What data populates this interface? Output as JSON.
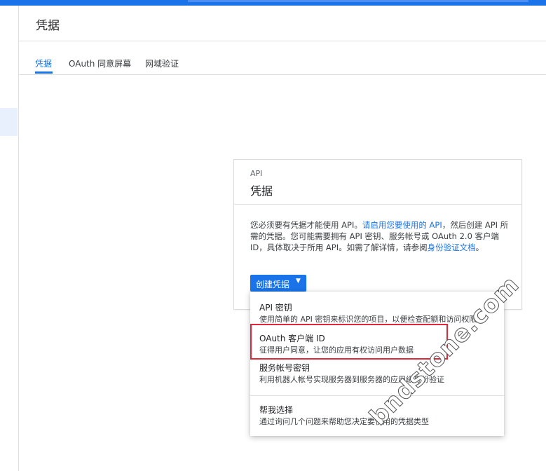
{
  "header": {
    "title": "凭据"
  },
  "tabs": [
    {
      "label": "凭据",
      "active": true
    },
    {
      "label": "OAuth 同意屏幕",
      "active": false
    },
    {
      "label": "网域验证",
      "active": false
    }
  ],
  "card": {
    "overline": "API",
    "title": "凭据",
    "body": {
      "part1": "您必须要有凭据才能使用 API。",
      "link1": "请启用您要使用的 API",
      "part2": "，然后创建 API 所需的凭据。您可能需要拥有 API 密钥、服务帐号或 OAuth 2.0 客户端 ID，具体取决于所用 API。如需了解详情，请参阅",
      "link2": "身份验证文档",
      "part3": "。"
    }
  },
  "create_button": {
    "label": "创建凭据"
  },
  "menu": {
    "items": [
      {
        "title": "API 密钥",
        "desc": "使用简单的 API 密钥来标识您的项目，以便检查配额和访问权限"
      },
      {
        "title": "OAuth 客户端 ID",
        "desc": "征得用户同意，让您的应用有权访问用户数据"
      },
      {
        "title": "服务帐号密钥",
        "desc": "利用机器人帐号实现服务器到服务器的应用级身份验证"
      },
      {
        "title": "帮我选择",
        "desc": "通过询问几个问题来帮助您决定要使用的凭据类型"
      }
    ]
  },
  "watermark": "bndstone.com",
  "colors": {
    "accent": "#1a73e8",
    "highlight": "#e0283a"
  }
}
